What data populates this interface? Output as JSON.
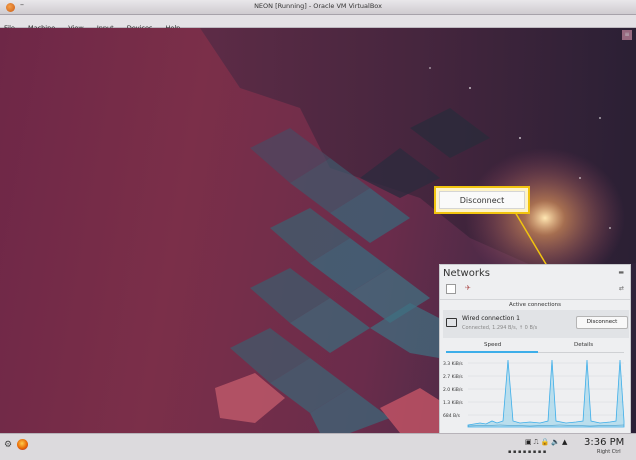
{
  "window": {
    "title": "NEON [Running] - Oracle VM VirtualBox",
    "control": "–"
  },
  "menu": {
    "items": [
      "File",
      "Machine",
      "View",
      "Input",
      "Devices",
      "Help"
    ]
  },
  "callout": {
    "label": "Disconnect"
  },
  "networks": {
    "title": "Networks",
    "active_header": "Active connections",
    "connection": {
      "name": "Wired connection 1",
      "status": "Connected, 1.294 B/s, ↑ 0 B/s",
      "button": "Disconnect"
    },
    "tabs": [
      "Speed",
      "Details"
    ],
    "active_tab": "Speed",
    "chart_labels": [
      "3.3 KiB/s",
      "2.7 KiB/s",
      "2.0 KiB/s",
      "1.3 KiB/s",
      "684 B/s"
    ]
  },
  "taskbar": {
    "clock": "3:36 PM",
    "host_key": "Right Ctrl"
  },
  "colors": {
    "accent": "#3daee9",
    "callout_border": "#f1c40f",
    "desktop": "#6e2747"
  },
  "icons": [
    "virtualbox-icon",
    "kde-start-icon",
    "firefox-icon",
    "airplane-mode-icon",
    "refresh-icon",
    "monitor-icon",
    "speaker-icon",
    "lock-icon"
  ]
}
